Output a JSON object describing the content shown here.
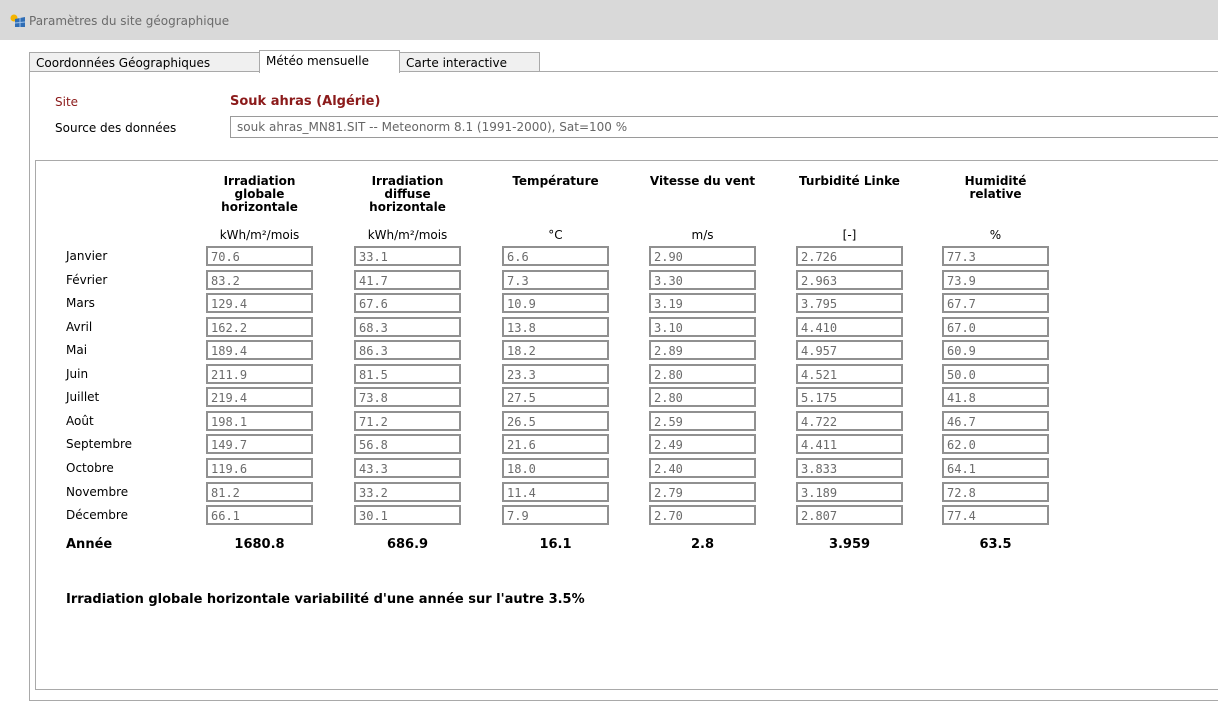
{
  "window": {
    "title": "Paramètres du site géographique"
  },
  "tabs": [
    {
      "label": "Coordonnées Géographiques",
      "active": false
    },
    {
      "label": "Météo mensuelle",
      "active": true
    },
    {
      "label": "Carte interactive",
      "active": false
    }
  ],
  "site": {
    "label": "Site",
    "name": "Souk ahras   (Algérie)"
  },
  "source": {
    "label": "Source des données",
    "value": "souk ahras_MN81.SIT -- Meteonorm 8.1 (1991-2000), Sat=100 %"
  },
  "columns": [
    {
      "header": "Irradiation\nglobale\nhorizontale",
      "unit": "kWh/m²/mois"
    },
    {
      "header": "Irradiation\ndiffuse\nhorizontale",
      "unit": "kWh/m²/mois"
    },
    {
      "header": "Température",
      "unit": "°C"
    },
    {
      "header": "Vitesse du vent",
      "unit": "m/s"
    },
    {
      "header": "Turbidité Linke",
      "unit": "[-]"
    },
    {
      "header": "Humidité\nrelative",
      "unit": "%"
    }
  ],
  "rows": [
    {
      "month": "Janvier",
      "values": [
        "70.6",
        "33.1",
        "6.6",
        "2.90",
        "2.726",
        "77.3"
      ]
    },
    {
      "month": "Février",
      "values": [
        "83.2",
        "41.7",
        "7.3",
        "3.30",
        "2.963",
        "73.9"
      ]
    },
    {
      "month": "Mars",
      "values": [
        "129.4",
        "67.6",
        "10.9",
        "3.19",
        "3.795",
        "67.7"
      ]
    },
    {
      "month": "Avril",
      "values": [
        "162.2",
        "68.3",
        "13.8",
        "3.10",
        "4.410",
        "67.0"
      ]
    },
    {
      "month": "Mai",
      "values": [
        "189.4",
        "86.3",
        "18.2",
        "2.89",
        "4.957",
        "60.9"
      ]
    },
    {
      "month": "Juin",
      "values": [
        "211.9",
        "81.5",
        "23.3",
        "2.80",
        "4.521",
        "50.0"
      ]
    },
    {
      "month": "Juillet",
      "values": [
        "219.4",
        "73.8",
        "27.5",
        "2.80",
        "5.175",
        "41.8"
      ]
    },
    {
      "month": "Août",
      "values": [
        "198.1",
        "71.2",
        "26.5",
        "2.59",
        "4.722",
        "46.7"
      ]
    },
    {
      "month": "Septembre",
      "values": [
        "149.7",
        "56.8",
        "21.6",
        "2.49",
        "4.411",
        "62.0"
      ]
    },
    {
      "month": "Octobre",
      "values": [
        "119.6",
        "43.3",
        "18.0",
        "2.40",
        "3.833",
        "64.1"
      ]
    },
    {
      "month": "Novembre",
      "values": [
        "81.2",
        "33.2",
        "11.4",
        "2.79",
        "3.189",
        "72.8"
      ]
    },
    {
      "month": "Décembre",
      "values": [
        "66.1",
        "30.1",
        "7.9",
        "2.70",
        "2.807",
        "77.4"
      ]
    }
  ],
  "totals": {
    "label": "Année",
    "values": [
      "1680.8",
      "686.9",
      "16.1",
      "2.8",
      "3.959",
      "63.5"
    ]
  },
  "variability": {
    "text": "Irradiation globale horizontale variabilité d'une année sur l'autre  3.5%"
  },
  "colors": {
    "site": "#8b1a1a",
    "titlebar": "#d9d9d9",
    "border": "#909090"
  },
  "icons": {
    "app": "solar-panel-icon"
  }
}
